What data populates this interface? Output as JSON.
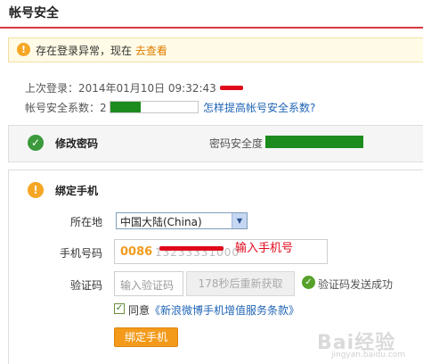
{
  "header": {
    "title": "帐号安全"
  },
  "notice": {
    "text": "存在登录异常，现在",
    "link": "去查看"
  },
  "login_info": {
    "last_login": "上次登录：2014年01月10日  09:32:43"
  },
  "security": {
    "label": "帐号安全系数：2",
    "level_fraction": 0.35,
    "help_link": "怎样提高帐号安全系数?"
  },
  "password_section": {
    "title": "修改密码",
    "strength_label": "密码安全度",
    "strength_fraction": 1.0
  },
  "bind_section": {
    "title": "绑定手机",
    "region_label": "所在地",
    "region_value": "中国大陆(China)",
    "phone_label": "手机号码",
    "phone_prefix": "0086",
    "phone_digits": "13233331000",
    "phone_annotation": "输入手机号",
    "code_label": "验证码",
    "code_placeholder": "输入验证码",
    "resend_label": "178秒后重新获取",
    "sent_message": "验证码发送成功",
    "agree_prefix": "同意",
    "agree_link": "《新浪微博手机增值服务条款》",
    "submit_label": "绑定手机"
  },
  "watermark": {
    "brand": "Bai经验",
    "site": "jingyan.baidu.com"
  },
  "colors": {
    "accent_red": "#d9373f",
    "security_green": "#1b8c1d",
    "link_blue": "#1f64b5",
    "warning_orange": "#f5a623",
    "button_orange": "#f39a1b"
  },
  "icons": {
    "notice": "warning-icon",
    "password": "check-circle-icon",
    "bind": "warning-icon",
    "sent": "check-circle-icon",
    "dropdown": "chevron-down-icon"
  }
}
